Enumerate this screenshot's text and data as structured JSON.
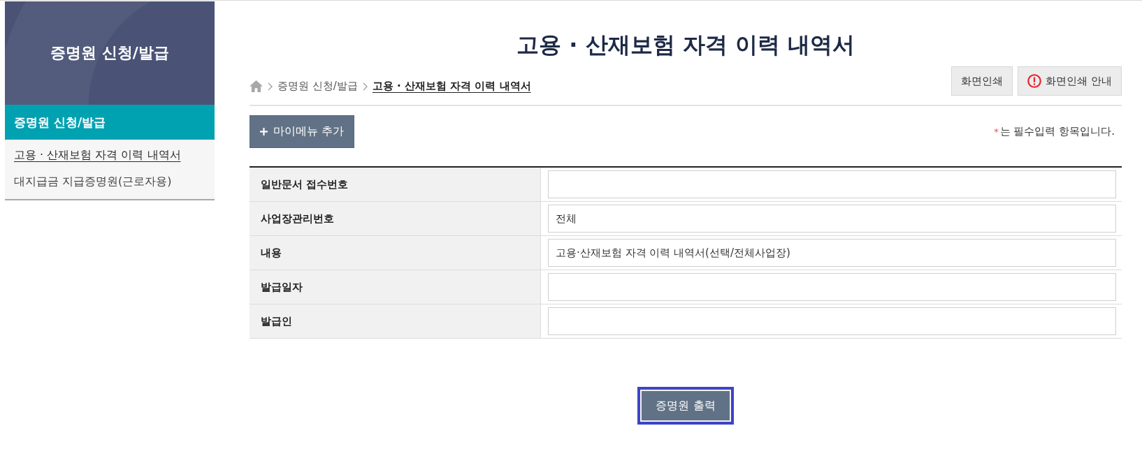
{
  "sidebar": {
    "banner_title": "증명원 신청/발급",
    "section_title": "증명원 신청/발급",
    "items": [
      {
        "label": "고용 · 산재보험 자격 이력 내역서",
        "selected": true
      },
      {
        "label": "대지급금 지급증명원(근로자용)",
        "selected": false
      }
    ]
  },
  "page_title": "고용 · 산재보험 자격 이력 내역서",
  "breadcrumb": [
    {
      "label": "증명원 신청/발급",
      "current": false
    },
    {
      "label": "고용 · 산재보험 자격 이력 내역서",
      "current": true
    }
  ],
  "print_buttons": [
    {
      "label": "화면인쇄",
      "kind": "plain"
    },
    {
      "label": "화면인쇄 안내",
      "kind": "info"
    }
  ],
  "my_menu_button": {
    "label": "마이메뉴 추가"
  },
  "required_note": {
    "mark": "*",
    "text": "는 필수입력 항목입니다."
  },
  "form": {
    "rows": [
      {
        "label": "일반문서 접수번호"
      },
      {
        "label": "사업장관리번호",
        "value": "전체"
      },
      {
        "label": "내용",
        "value": "고용·산재보험 자격 이력 내역서(선택/전체사업장)"
      },
      {
        "label": "발급일자"
      },
      {
        "label": "발급인"
      }
    ]
  },
  "submit_button": {
    "label": "증명원 출력",
    "focused": true
  }
}
